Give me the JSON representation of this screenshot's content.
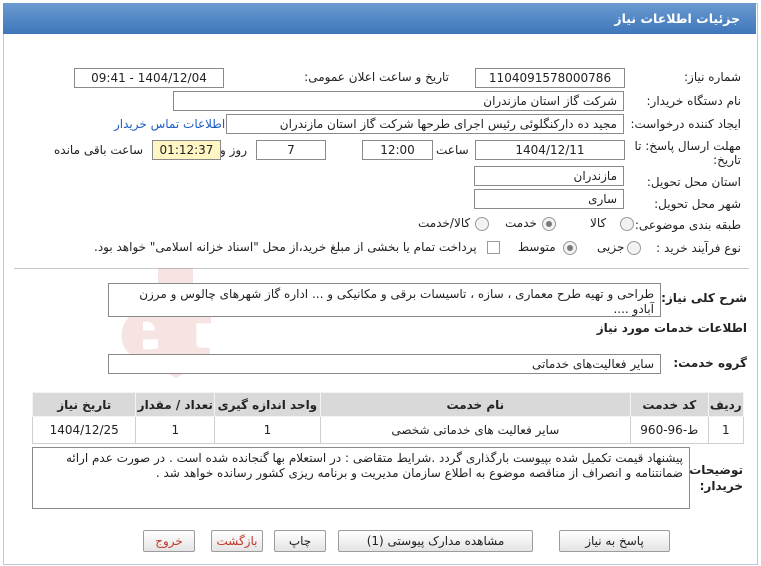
{
  "header": {
    "title": "جزئیات اطلاعات نیاز"
  },
  "fields": {
    "need_number_label": "شماره نیاز:",
    "need_number": "1104091578000786",
    "announce_label": "تاریخ و ساعت اعلان عمومی:",
    "announce_value": "1404/12/04 - 09:41",
    "buyer_org_label": "نام دستگاه خریدار:",
    "buyer_org": "شرکت گاز استان مازندران",
    "requester_label": "ایجاد کننده درخواست:",
    "requester": "مجید ده دارکنگلوئی رئیس اجرای طرحها شرکت گاز استان مازندران",
    "contact_link": "اطلاعات تماس خریدار",
    "deadline_label_1": "مهلت ارسال پاسخ: تا",
    "deadline_label_2": "تاریخ:",
    "deadline_date": "1404/12/11",
    "time_label": "ساعت",
    "deadline_time": "12:00",
    "days_value": "7",
    "days_label": "روز و",
    "remaining_time": "01:12:37",
    "remaining_label": "ساعت باقی مانده",
    "province_label": "استان محل تحویل:",
    "province": "مازندران",
    "city_label": "شهر محل تحویل:",
    "city": "ساری",
    "category_label": "طبقه بندی موضوعی:",
    "category_options": [
      "کالا",
      "خدمت",
      "کالا/خدمت"
    ],
    "process_label": "نوع فرآیند خرید :",
    "process_options": [
      "جزیی",
      "متوسط"
    ],
    "payment_note": "پرداخت تمام یا بخشی از مبلغ خرید،از محل \"اسناد خزانه اسلامی\" خواهد بود."
  },
  "summary": {
    "label": "شرح کلی نیاز:",
    "text": "طراحی و تهیه طرح معماری ، سازه ، تاسیسات برقی و مکانیکی و ... اداره گاز شهرهای چالوس و مرزن آبادو ...."
  },
  "services": {
    "section_title": "اطلاعات خدمات مورد نیاز",
    "group_label": "گروه خدمت:",
    "group_value": "سایر فعالیت‌های خدماتی"
  },
  "table": {
    "headers": [
      "ردیف",
      "کد خدمت",
      "نام خدمت",
      "واحد اندازه گیری",
      "تعداد / مقدار",
      "تاریخ نیاز"
    ],
    "rows": [
      [
        "1",
        "ط-96-960",
        "سایر فعالیت های خدماتی شخصی",
        "1",
        "1",
        "1404/12/25"
      ]
    ]
  },
  "buyer_notes": {
    "label_1": "توضیحات",
    "label_2": "خریدار:",
    "text": "پیشنهاد قیمت تکمیل شده بپیوست  بارگذاری گردد .شرایط متقاضی : در استعلام بها گنجانده شده است . در صورت عدم ارائه ضمانتنامه و انصراف از مناقصه موضوع به اطلاع سازمان مدیریت و برنامه ریزی کشور رسانده خواهد شد ."
  },
  "buttons": {
    "reply": "پاسخ به نیاز",
    "attachments": "مشاهده مدارک پیوستی (1)",
    "print": "چاپ",
    "back": "بازگشت",
    "exit": "خروج"
  },
  "watermark": {
    "text": "AriaTender.net"
  },
  "colors": {
    "header_bg": "#4a80c2",
    "link": "#1b5fc2",
    "watermark": "#c0392b"
  }
}
